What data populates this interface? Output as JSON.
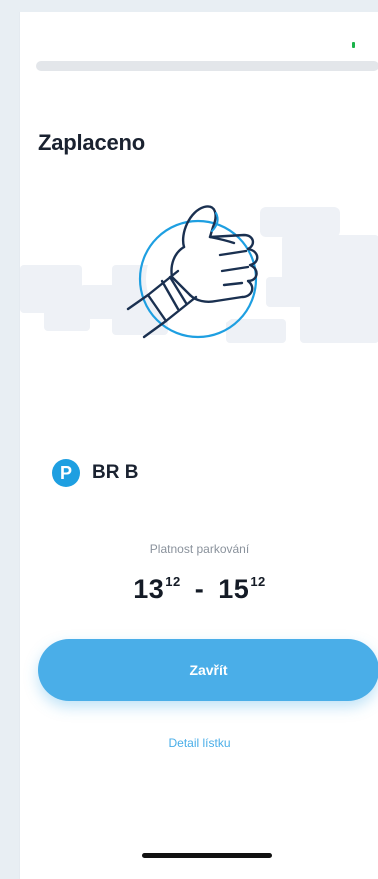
{
  "header": {
    "title": "Zaplaceno"
  },
  "illustration": {
    "icon": "thumbs-up-icon",
    "stroke_color": "#1a3050",
    "accent_color": "#1e9fe1",
    "cloud_color": "#eef1f6"
  },
  "ticket": {
    "zone_icon": "P",
    "zone_name": "BR B",
    "validity_label": "Platnost parkování",
    "start_hour": "13",
    "start_minute": "12",
    "separator": "-",
    "end_hour": "15",
    "end_minute": "12"
  },
  "actions": {
    "close_label": "Zavřít",
    "detail_label": "Detail lístku"
  },
  "colors": {
    "primary": "#4aaee8",
    "parking_badge": "#1e9fe1",
    "text_dark": "#1a2230",
    "text_muted": "#8a929c"
  }
}
